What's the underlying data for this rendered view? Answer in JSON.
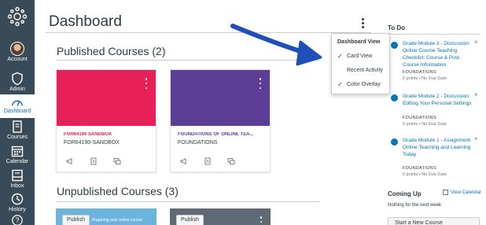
{
  "nav": {
    "items": [
      {
        "label": "Account",
        "icon": "account-avatar"
      },
      {
        "label": "Admin",
        "icon": "shield-icon"
      },
      {
        "label": "Dashboard",
        "icon": "dashboard-icon"
      },
      {
        "label": "Courses",
        "icon": "courses-icon"
      },
      {
        "label": "Calendar",
        "icon": "calendar-icon"
      },
      {
        "label": "Inbox",
        "icon": "inbox-icon"
      },
      {
        "label": "History",
        "icon": "clock-icon"
      }
    ],
    "help_icon": "help-icon",
    "colors": {
      "background": "#394b58",
      "active": "#0374b5"
    }
  },
  "header": {
    "title": "Dashboard"
  },
  "published": {
    "title": "Published Courses (2)",
    "cards": [
      {
        "name": "FOR64190 SANDBOX",
        "code": "FOR64190-SANDBOX",
        "color": "#e8205a",
        "name_color": "#e8205a"
      },
      {
        "name": "FOUNDATIONS OF ONLINE TEA...",
        "code": "FOUNDATIONS",
        "color": "#5c3e99",
        "name_color": "#5c3e99"
      }
    ]
  },
  "unpublished": {
    "title": "Unpublished Courses (3)",
    "publish_label": "Publish",
    "cards": [
      {
        "color": "#6db4dc",
        "caption": "Preparing your online course"
      },
      {
        "color": "#5f6a75",
        "caption": ""
      }
    ]
  },
  "menu": {
    "title": "Dashboard View",
    "items": [
      {
        "label": "Card View",
        "checked": true
      },
      {
        "label": "Recent Activity",
        "checked": false
      },
      {
        "label": "Color Overlay",
        "checked": true
      }
    ]
  },
  "todo": {
    "title": "To Do",
    "items": [
      {
        "link": "Grade Module 3 - Discussion: Online Course Teaching Checklist: Course & Post-Course Information",
        "course": "FOUNDATIONS",
        "meta": "0 points • No Due Date"
      },
      {
        "link": "Grade Module 2 - Discussion: Editing Your Personal Settings",
        "course": "FOUNDATIONS",
        "meta": "0 points • No Due Date"
      },
      {
        "link": "Grade Module 1 - Assignment: Online Teaching and Learning Today",
        "course": "FOUNDATIONS",
        "meta": "0 points • No Due Date"
      }
    ]
  },
  "coming_up": {
    "title": "Coming Up",
    "calendar_link": "View Calendar",
    "empty_text": "Nothing for the next week",
    "new_course_label": "Start a New Course"
  }
}
